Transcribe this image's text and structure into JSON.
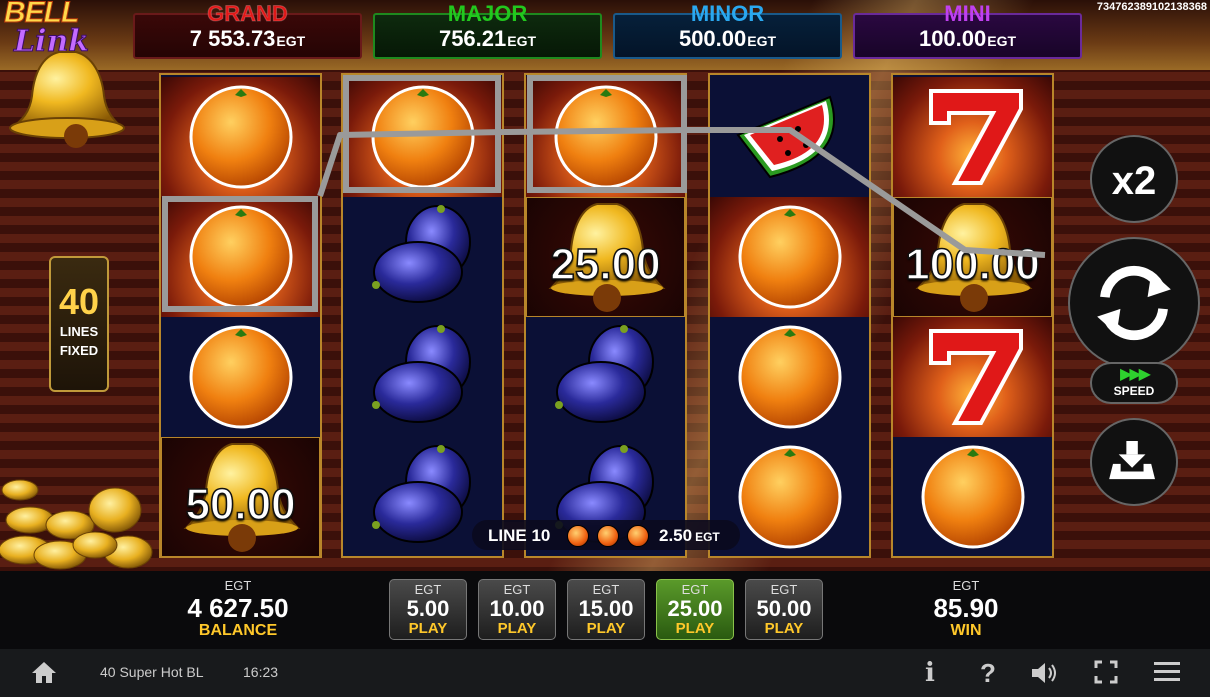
{
  "jackpots": [
    {
      "name": "GRAND",
      "value": "7 553.73",
      "unit": "EGT"
    },
    {
      "name": "MAJOR",
      "value": "756.21",
      "unit": "EGT"
    },
    {
      "name": "MINOR",
      "value": "500.00",
      "unit": "EGT"
    },
    {
      "name": "MINI",
      "value": "100.00",
      "unit": "EGT"
    }
  ],
  "game_id": "734762389102138368",
  "logo": {
    "word1": "BELL",
    "word2": "Link"
  },
  "lines_panel": {
    "count": "40",
    "label1": "LINES",
    "label2": "FIXED"
  },
  "reels": [
    [
      "orange",
      "orange",
      "orange",
      "bell:50.00"
    ],
    [
      "orange",
      "plum",
      "plum",
      "plum"
    ],
    [
      "orange",
      "bell:25.00",
      "plum",
      "plum"
    ],
    [
      "watermelon",
      "orange",
      "orange",
      "orange"
    ],
    [
      "seven",
      "bell:100.00",
      "seven",
      "orange"
    ]
  ],
  "bell_values": {
    "reel1": "50.00",
    "reel3": "25.00",
    "reel5": "100.00"
  },
  "win_line": {
    "label": "LINE 10",
    "amount": "2.50",
    "unit": "EGT",
    "symbol_count": 3
  },
  "buttons": {
    "multiplier": "x2",
    "speed": "SPEED"
  },
  "balance": {
    "currency": "EGT",
    "value": "4 627.50",
    "label": "BALANCE"
  },
  "win": {
    "currency": "EGT",
    "value": "85.90",
    "label": "WIN"
  },
  "bets": [
    {
      "currency": "EGT",
      "value": "5.00",
      "label": "PLAY",
      "active": false
    },
    {
      "currency": "EGT",
      "value": "10.00",
      "label": "PLAY",
      "active": false
    },
    {
      "currency": "EGT",
      "value": "15.00",
      "label": "PLAY",
      "active": false
    },
    {
      "currency": "EGT",
      "value": "25.00",
      "label": "PLAY",
      "active": true
    },
    {
      "currency": "EGT",
      "value": "50.00",
      "label": "PLAY",
      "active": false
    }
  ],
  "status_bar": {
    "game_name": "40 Super Hot BL",
    "time": "16:23",
    "info": "i",
    "help": "?"
  },
  "colors": {
    "grand": "#e01818",
    "major": "#22c81e",
    "minor": "#2aa8f0",
    "mini": "#c040f0",
    "gold_label": "#ffc82a",
    "active_bet": "#4a8a22"
  }
}
